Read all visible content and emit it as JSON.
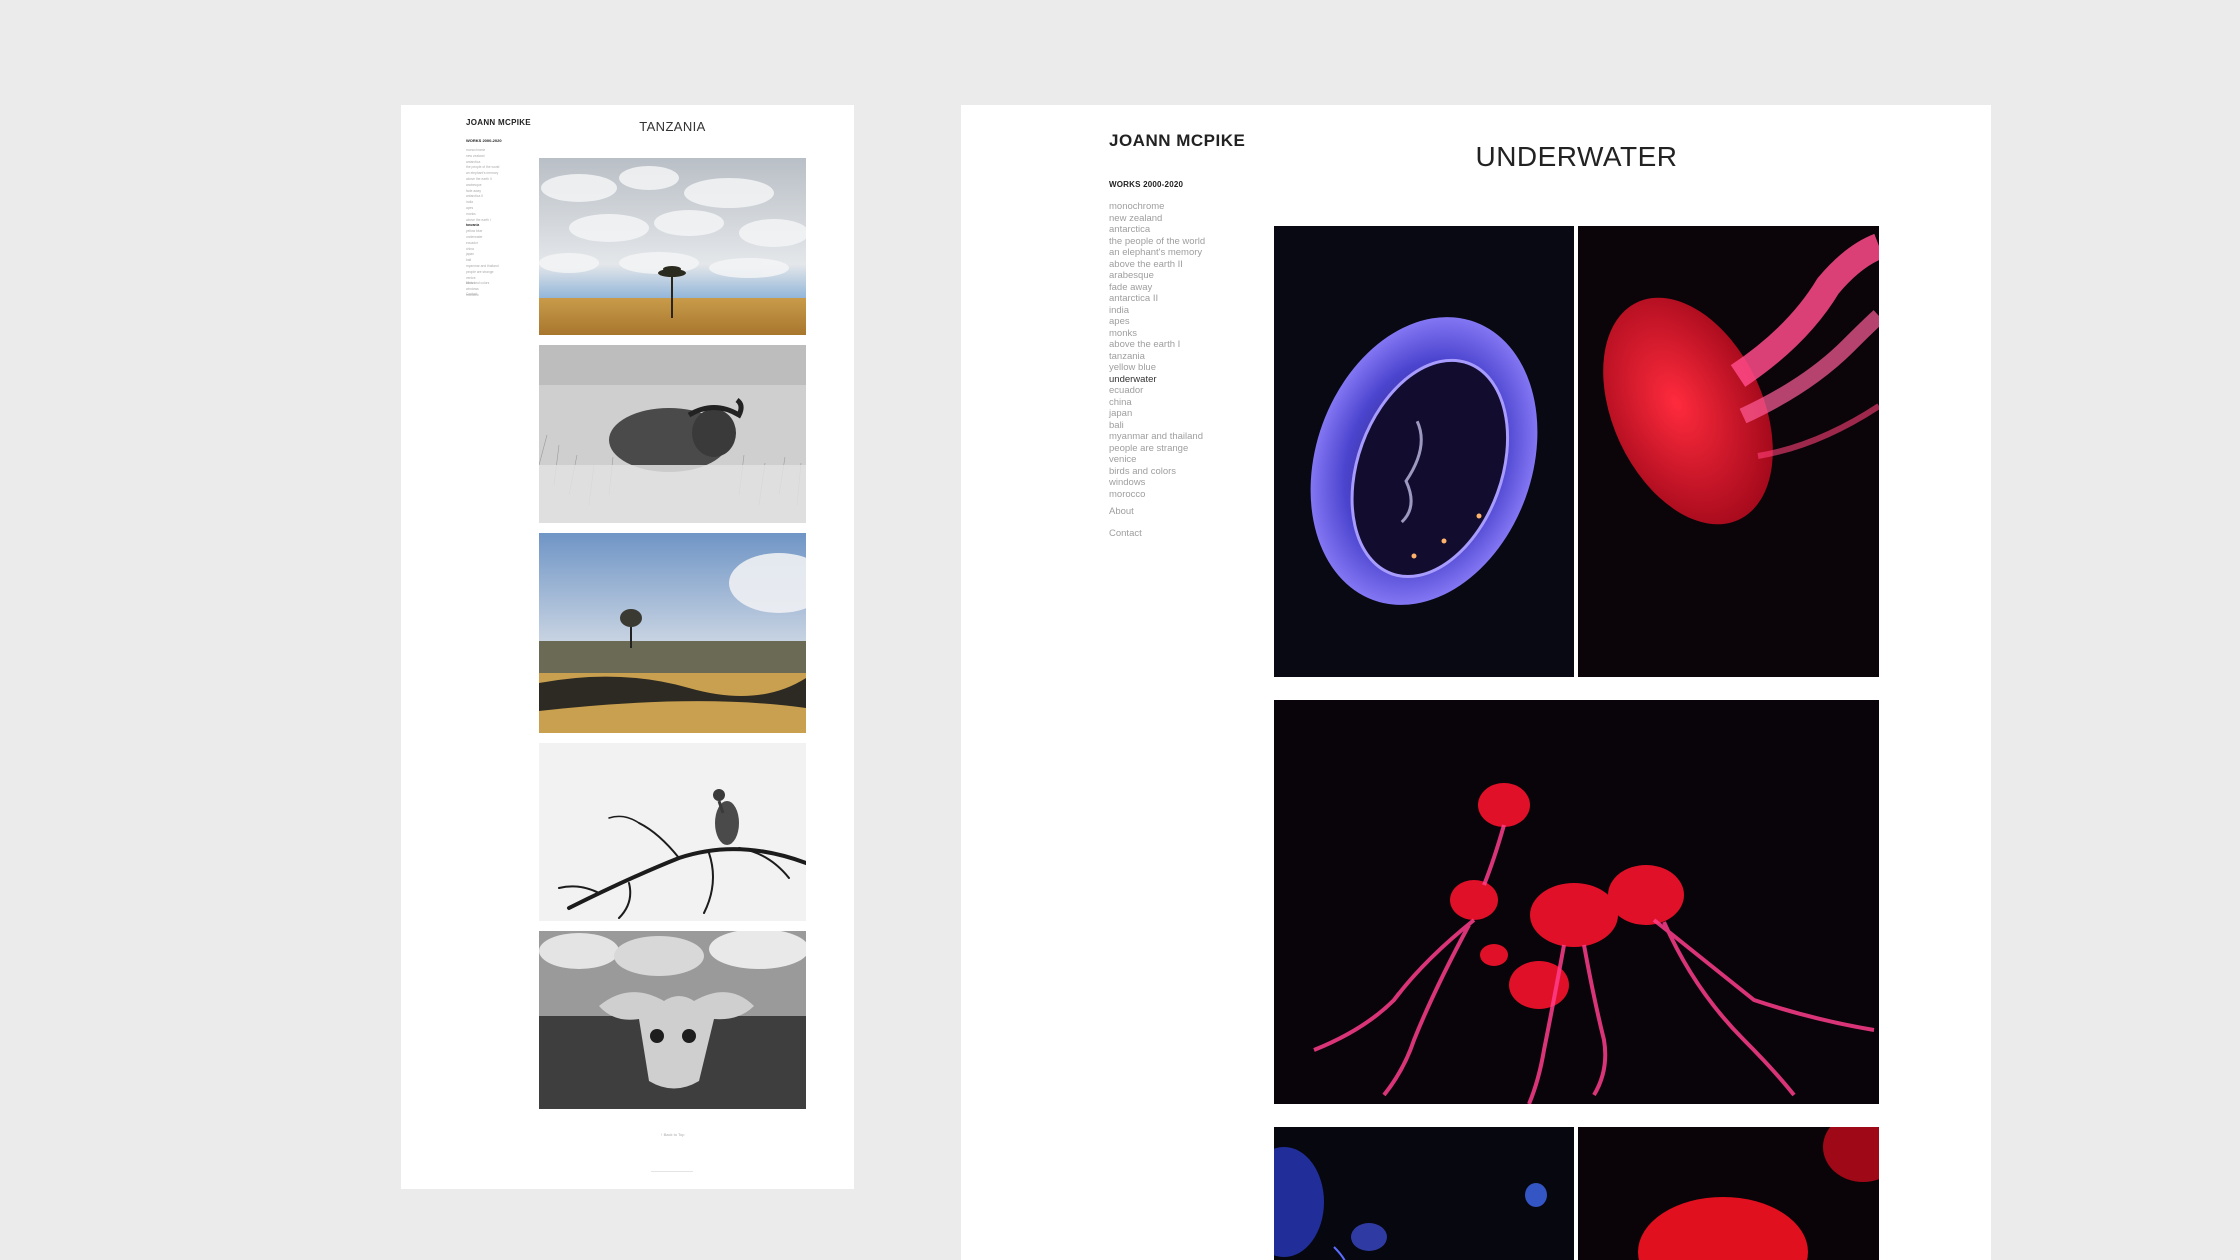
{
  "small_page": {
    "brand": "JOANN MCPIKE",
    "works": "WORKS 2000-2020",
    "title": "TANZANIA",
    "nav": [
      "monochrome",
      "new zealand",
      "antarctica",
      "the people of the world",
      "an elephant's memory",
      "above the earth II",
      "arabesque",
      "fade away",
      "antarctica II",
      "india",
      "apes",
      "monks",
      "above the earth I",
      "tanzania",
      "yellow blue",
      "underwater",
      "ecuador",
      "china",
      "japan",
      "bali",
      "myanmar and thailand",
      "people are strange",
      "venice",
      "birds and colors",
      "windows",
      "morocco"
    ],
    "nav_active_index": 13,
    "about": "About",
    "contact": "Contact",
    "back_to_top": "↑ Back to Top"
  },
  "large_page": {
    "brand": "JOANN MCPIKE",
    "works": "WORKS 2000-2020",
    "title": "UNDERWATER",
    "nav": [
      "monochrome",
      "new zealand",
      "antarctica",
      "the people of the world",
      "an elephant's memory",
      "above the earth II",
      "arabesque",
      "fade away",
      "antarctica II",
      "india",
      "apes",
      "monks",
      "above the earth I",
      "tanzania",
      "yellow blue",
      "underwater",
      "ecuador",
      "china",
      "japan",
      "bali",
      "myanmar and thailand",
      "people are strange",
      "venice",
      "birds and colors",
      "windows",
      "morocco"
    ],
    "nav_active_index": 15,
    "about": "About",
    "contact": "Contact"
  },
  "colors": {
    "background": "#ebebeb",
    "page": "#ffffff",
    "nav_text": "#9e9e9e",
    "active_text": "#333333"
  },
  "photos": {
    "small": [
      "tree-under-clouds-photo",
      "buffalo-photo",
      "tree-burnt-savanna-photo",
      "vulture-on-branch-photo",
      "buffalo-skull-photo"
    ],
    "large": [
      "blue-moon-jellyfish-photo",
      "red-jellyfish-photo",
      "red-jellyfish-group-photo",
      "blue-jellyfish-photo",
      "red-jellyfish-bell-photo"
    ]
  }
}
